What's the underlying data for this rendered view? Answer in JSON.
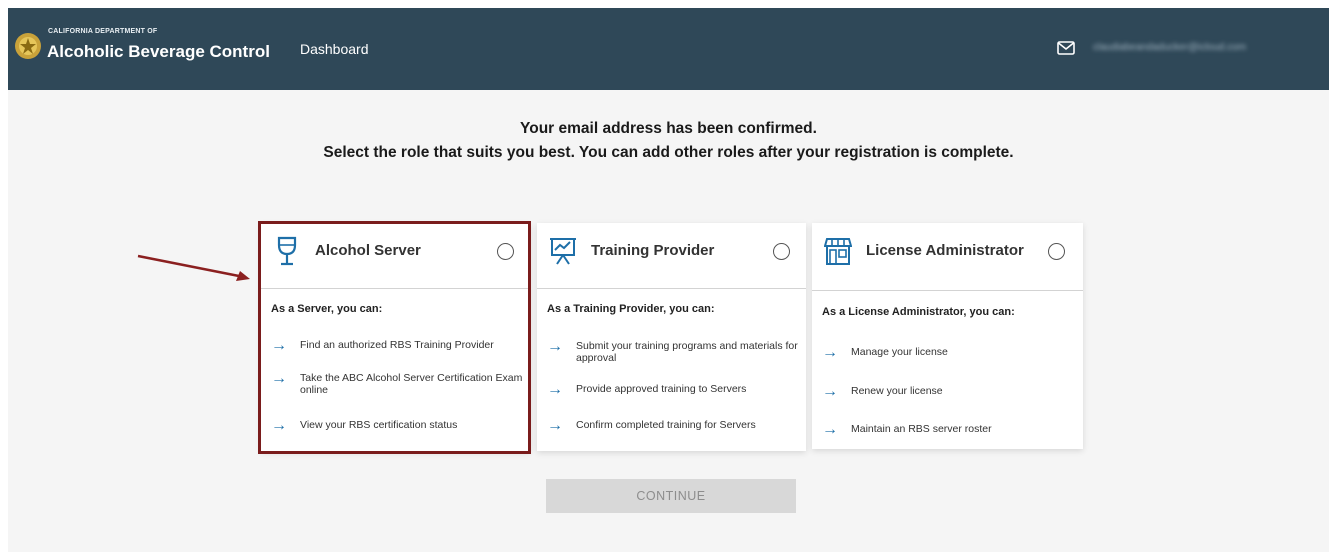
{
  "header": {
    "brand_small": "CALIFORNIA DEPARTMENT OF",
    "brand_big": "Alcoholic Beverage Control",
    "nav_dashboard": "Dashboard",
    "user_email": "claudiabeandaducker@icloud.com"
  },
  "headline": {
    "line1": "Your email address has been confirmed.",
    "line2": "Select the role that suits you best. You can add other roles after your registration is complete."
  },
  "cards": [
    {
      "title": "Alcohol Server",
      "icon": "wine-glass-icon",
      "subtitle": "As a Server, you can:",
      "items": [
        "Find an authorized RBS Training Provider",
        "Take the ABC Alcohol Server Certification Exam online",
        "View your RBS certification status"
      ],
      "selected": false
    },
    {
      "title": "Training Provider",
      "icon": "presentation-icon",
      "subtitle": "As a Training Provider, you can:",
      "items": [
        "Submit your training programs and materials for approval",
        "Provide approved training to Servers",
        "Confirm completed training for Servers"
      ],
      "selected": false
    },
    {
      "title": "License Administrator",
      "icon": "storefront-icon",
      "subtitle": "As a License Administrator, you can:",
      "items": [
        "Manage your license",
        "Renew your license",
        "Maintain an RBS server roster"
      ],
      "selected": false
    }
  ],
  "continue_label": "CONTINUE",
  "colors": {
    "header_bg": "#2f4858",
    "accent_arrow": "#1e6fa8",
    "highlight": "#7a1c1c"
  }
}
